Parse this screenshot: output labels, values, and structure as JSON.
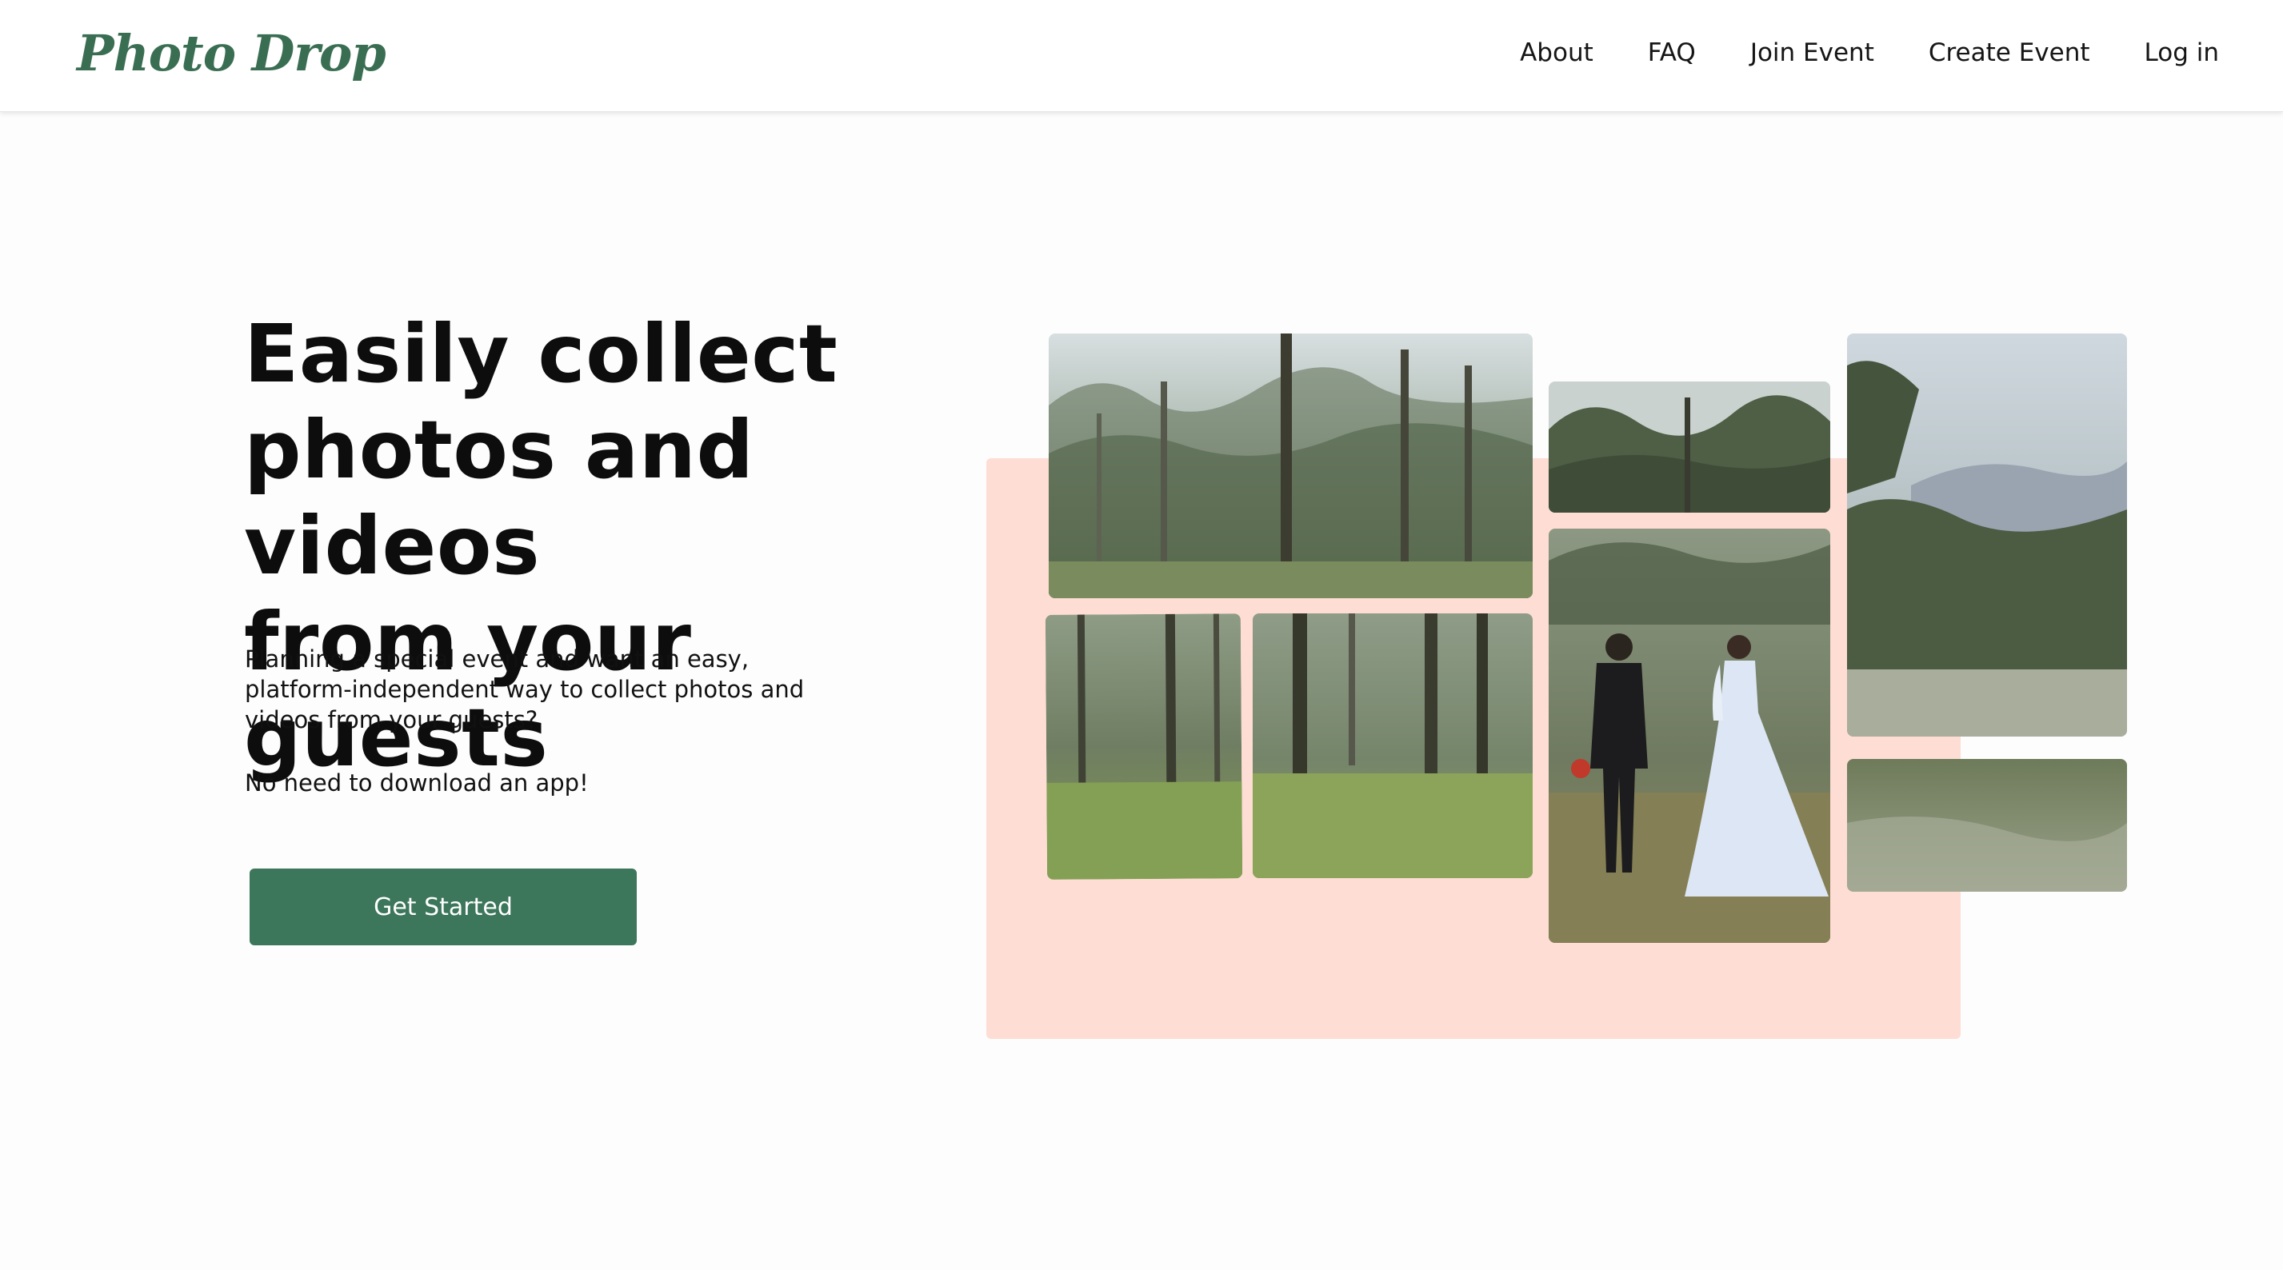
{
  "header": {
    "logo": "Photo Drop",
    "nav": {
      "about": "About",
      "faq": "FAQ",
      "join_event": "Join Event",
      "create_event": "Create Event",
      "log_in": "Log in"
    }
  },
  "hero": {
    "title_line1": "Easily collect",
    "title_line2": "photos and videos",
    "title_line3": "from your guests",
    "desc_line1": "Planning a special event and want an easy,",
    "desc_line2": "platform-independent way to collect photos and",
    "desc_line3": "videos from your guests?",
    "note": "No need to download an app!",
    "cta_label": "Get Started"
  },
  "colors": {
    "brand": "#3c765b",
    "logo": "#3a6e52",
    "collage_backdrop": "#fdddd4"
  }
}
